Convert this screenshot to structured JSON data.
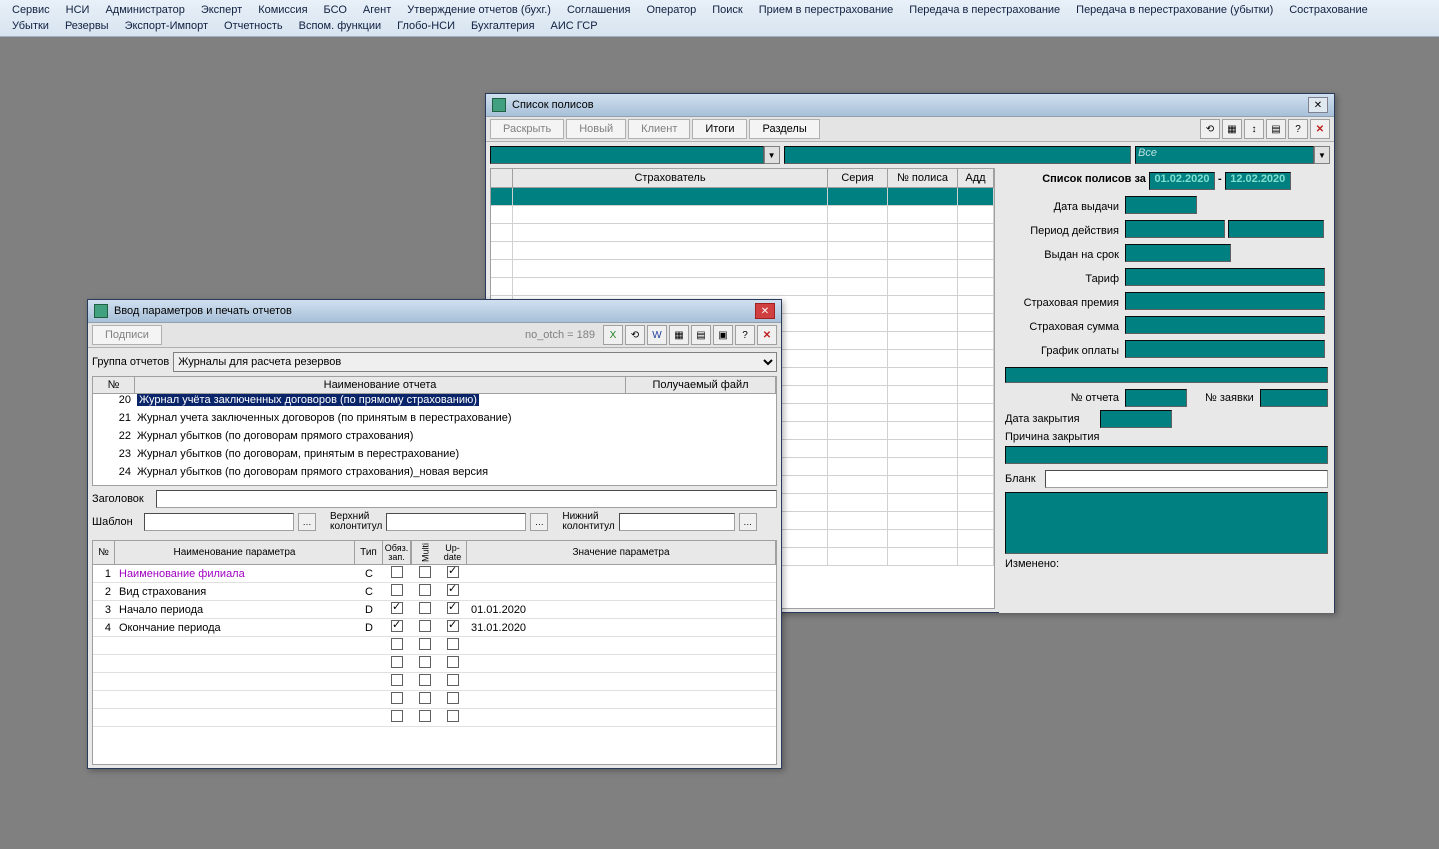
{
  "menubar": {
    "row1": [
      "Сервис",
      "НСИ",
      "Администратор",
      "Эксперт",
      "Комиссия",
      "БСО",
      "Агент",
      "Утверждение отчетов (бухг.)",
      "Соглашения",
      "Оператор",
      "Поиск",
      "Прием в перестрахование",
      "Передача в перестрахование",
      "Передача в перестрахование (убытки)",
      "Сострахование"
    ],
    "row2": [
      "Убытки",
      "Резервы",
      "Экспорт-Импорт",
      "Отчетность",
      "Вспом. функции",
      "Глобо-НСИ",
      "Бухгалтерия",
      "АИС ГСР"
    ]
  },
  "policyWindow": {
    "title": "Список полисов",
    "toolbar": [
      "Раскрыть",
      "Новый",
      "Клиент",
      "Итоги",
      "Разделы"
    ],
    "filter_all": "Все",
    "grid_headers": [
      "Страхователь",
      "Серия",
      "№ полиса",
      "Адд"
    ],
    "side": {
      "header_prefix": "Список полисов за",
      "date_from": "01.02.2020",
      "date_to": "12.02.2020",
      "labels": {
        "issue_date": "Дата выдачи",
        "period": "Период действия",
        "issued_for": "Выдан на срок",
        "tariff": "Тариф",
        "premium": "Страховая премия",
        "sum": "Страховая сумма",
        "pay_schedule": "График оплаты",
        "report_no": "№ отчета",
        "request_no": "№ заявки",
        "close_date": "Дата закрытия",
        "close_reason": "Причина закрытия",
        "blank": "Бланк",
        "changed": "Изменено:"
      }
    }
  },
  "reportsWindow": {
    "title": "Ввод параметров и печать отчетов",
    "btn_signatures": "Подписи",
    "static_label": "no_otch =  189",
    "group_label": "Группа отчетов",
    "group_value": "Журналы для расчета резервов",
    "list_headers": {
      "no": "№",
      "name": "Наименование отчета",
      "file": "Получаемый файл"
    },
    "rows": [
      {
        "no": "20",
        "name": "Журнал учёта заключенных договоров (по прямому страхованию)",
        "selected": true
      },
      {
        "no": "21",
        "name": "Журнал учета заключенных договоров (по принятым в перестрахование)"
      },
      {
        "no": "22",
        "name": "Журнал убытков (по  договорам прямого страхования)"
      },
      {
        "no": "23",
        "name": "Журнал убытков (по  договорам, принятым в перестрахование)"
      },
      {
        "no": "24",
        "name": "Журнал убытков (по  договорам прямого страхования)_новая версия"
      }
    ],
    "mid": {
      "zag_label": "Заголовок",
      "template_label": "Шаблон",
      "top_label1": "Верхний",
      "top_label2": "колонтитул",
      "bot_label1": "Нижний",
      "bot_label2": "колонтитул"
    },
    "param_headers": {
      "no": "№",
      "name": "Наименование параметра",
      "type": "Тип",
      "oblig": "Обяз. зап.",
      "multi": "Multi",
      "update": "Up-date",
      "value": "Значение параметра"
    },
    "params": [
      {
        "no": "1",
        "name": "Наименование филиала",
        "type": "C",
        "ob": false,
        "mu": false,
        "up": true,
        "val": "",
        "hl": true
      },
      {
        "no": "2",
        "name": "Вид страхования",
        "type": "C",
        "ob": false,
        "mu": false,
        "up": true,
        "val": ""
      },
      {
        "no": "3",
        "name": "Начало периода",
        "type": "D",
        "ob": true,
        "mu": false,
        "up": true,
        "val": "01.01.2020"
      },
      {
        "no": "4",
        "name": "Окончание периода",
        "type": "D",
        "ob": true,
        "mu": false,
        "up": true,
        "val": "31.01.2020"
      }
    ],
    "empty_param_rows": 5
  }
}
